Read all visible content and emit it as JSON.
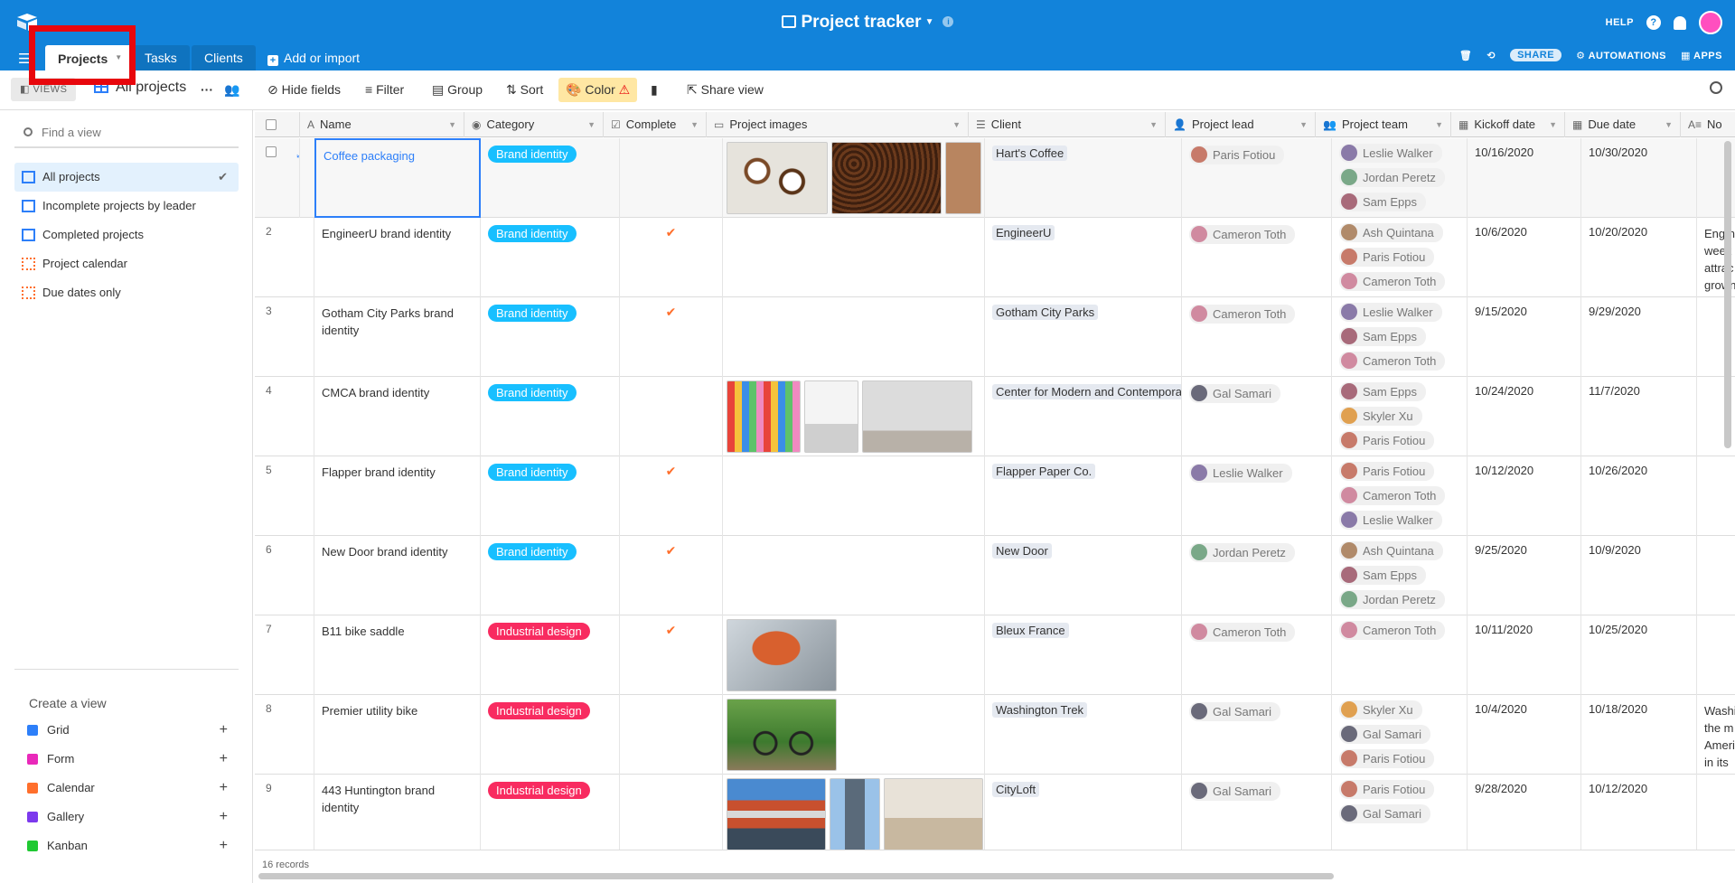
{
  "app": {
    "title": "Project tracker",
    "help_label": "HELP",
    "help_glyph": "?",
    "share_label": "SHARE",
    "automations_label": "AUTOMATIONS",
    "apps_label": "APPS"
  },
  "tabs": [
    {
      "label": "Projects",
      "active": true
    },
    {
      "label": "Tasks"
    },
    {
      "label": "Clients"
    }
  ],
  "add_import_label": "Add or import",
  "toolbar": {
    "views_label": "VIEWS",
    "current_view": "All projects",
    "more": "···",
    "hide_fields": "Hide fields",
    "filter": "Filter",
    "group": "Group",
    "sort": "Sort",
    "color": "Color",
    "share_view": "Share view"
  },
  "sidebar": {
    "find_placeholder": "Find a view",
    "views": [
      {
        "label": "All projects",
        "type": "grid",
        "active": true
      },
      {
        "label": "Incomplete projects by leader",
        "type": "grid"
      },
      {
        "label": "Completed projects",
        "type": "grid"
      },
      {
        "label": "Project calendar",
        "type": "calendar"
      },
      {
        "label": "Due dates only",
        "type": "calendar"
      }
    ],
    "create_title": "Create a view",
    "create_items": [
      {
        "label": "Grid",
        "color": "#2d7ff9"
      },
      {
        "label": "Form",
        "color": "#e929ba"
      },
      {
        "label": "Calendar",
        "color": "#ff6f2c"
      },
      {
        "label": "Gallery",
        "color": "#7c39ed"
      },
      {
        "label": "Kanban",
        "color": "#20c933"
      }
    ]
  },
  "columns": {
    "name": "Name",
    "category": "Category",
    "complete": "Complete",
    "images": "Project images",
    "client": "Client",
    "lead": "Project lead",
    "team": "Project team",
    "kickoff": "Kickoff date",
    "due": "Due date",
    "notes": "No"
  },
  "rows": [
    {
      "num": "",
      "name": "Coffee packaging",
      "category": "Brand identity",
      "complete": "",
      "client": "Hart's Coffee",
      "lead": "Paris Fotiou",
      "team": [
        "Leslie Walker",
        "Jordan Peretz",
        "Sam Epps"
      ],
      "kickoff": "10/16/2020",
      "due": "10/30/2020",
      "notes": ""
    },
    {
      "num": "2",
      "name": "EngineerU brand identity",
      "category": "Brand identity",
      "complete": "✔",
      "client": "EngineerU",
      "lead": "Cameron Toth",
      "team": [
        "Ash Quintana",
        "Paris Fotiou",
        "Cameron Toth"
      ],
      "kickoff": "10/6/2020",
      "due": "10/20/2020",
      "notes": "Eng ne week attrac grown"
    },
    {
      "num": "3",
      "name": "Gotham City Parks brand identity",
      "category": "Brand identity",
      "complete": "✔",
      "client": "Gotham City Parks",
      "lead": "Cameron Toth",
      "team": [
        "Leslie Walker",
        "Sam Epps",
        "Cameron Toth"
      ],
      "kickoff": "9/15/2020",
      "due": "9/29/2020",
      "notes": ""
    },
    {
      "num": "4",
      "name": "CMCA brand identity",
      "category": "Brand identity",
      "complete": "",
      "client": "Center for Modern and Contempora",
      "lead": "Gal Samari",
      "team": [
        "Sam Epps",
        "Skyler Xu",
        "Paris Fotiou"
      ],
      "kickoff": "10/24/2020",
      "due": "11/7/2020",
      "notes": ""
    },
    {
      "num": "5",
      "name": "Flapper brand identity",
      "category": "Brand identity",
      "complete": "✔",
      "client": "Flapper Paper Co.",
      "lead": "Leslie Walker",
      "team": [
        "Paris Fotiou",
        "Cameron Toth",
        "Leslie Walker"
      ],
      "kickoff": "10/12/2020",
      "due": "10/26/2020",
      "notes": ""
    },
    {
      "num": "6",
      "name": "New Door brand identity",
      "category": "Brand identity",
      "complete": "✔",
      "client": "New Door",
      "lead": "Jordan Peretz",
      "team": [
        "Ash Quintana",
        "Sam Epps",
        "Jordan Peretz"
      ],
      "kickoff": "9/25/2020",
      "due": "10/9/2020",
      "notes": ""
    },
    {
      "num": "7",
      "name": "B11 bike saddle",
      "category": "Industrial design",
      "complete": "✔",
      "client": "Bleux France",
      "lead": "Cameron Toth",
      "team": [
        "Cameron Toth"
      ],
      "kickoff": "10/11/2020",
      "due": "10/25/2020",
      "notes": ""
    },
    {
      "num": "8",
      "name": "Premier utility bike",
      "category": "Industrial design",
      "complete": "",
      "client": "Washington Trek",
      "lead": "Gal Samari",
      "team": [
        "Skyler Xu",
        "Gal Samari",
        "Paris Fotiou"
      ],
      "kickoff": "10/4/2020",
      "due": "10/18/2020",
      "notes": "Washi the m Ameri in its"
    },
    {
      "num": "9",
      "name": "443 Huntington brand identity",
      "category": "Industrial design",
      "complete": "",
      "client": "CityLoft",
      "lead": "Gal Samari",
      "team": [
        "Paris Fotiou",
        "Gal Samari"
      ],
      "kickoff": "9/28/2020",
      "due": "10/12/2020",
      "notes": ""
    }
  ],
  "record_count": "16 records"
}
